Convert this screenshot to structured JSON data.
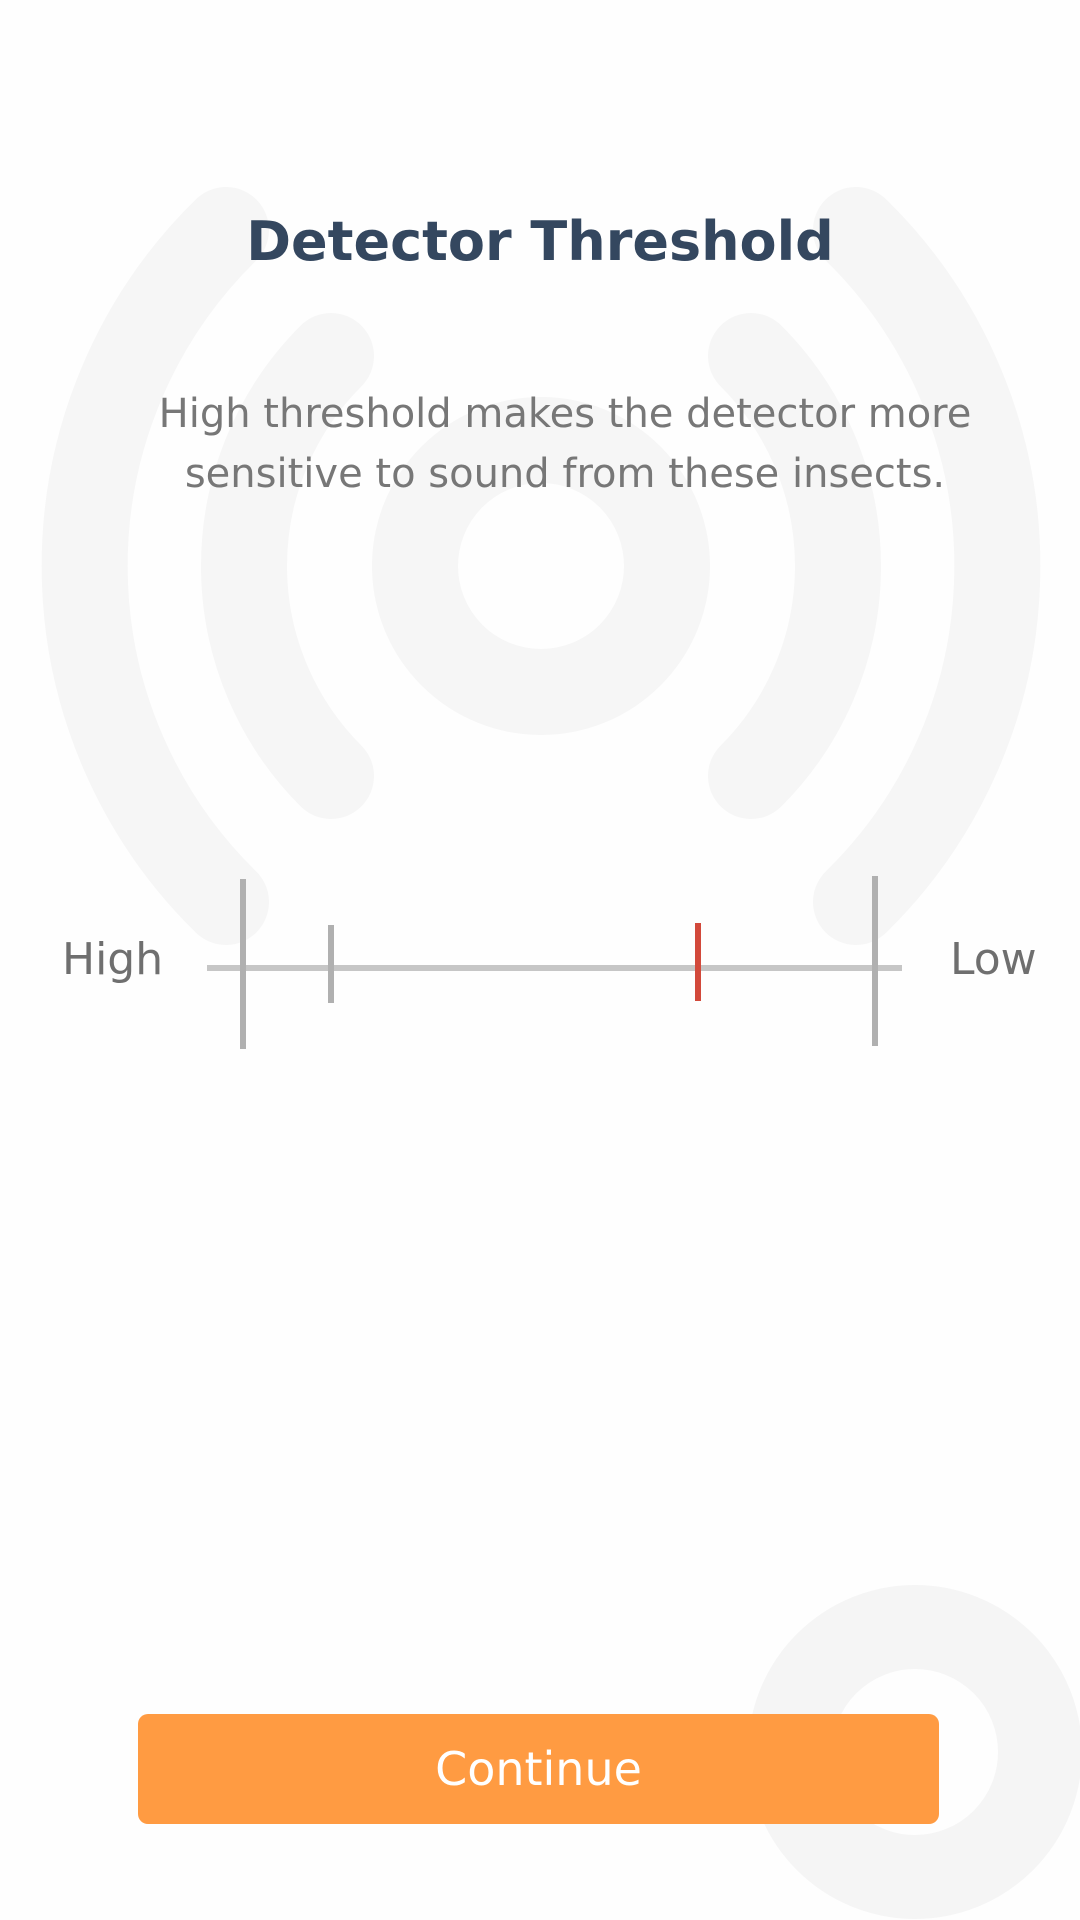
{
  "header": {
    "title": "Detector Threshold",
    "description": "High threshold makes the detector more sensitive to sound from these insects."
  },
  "threshold_slider": {
    "left_label": "High",
    "right_label": "Low",
    "value_fraction": 0.72,
    "default_marker_fraction": 0.14
  },
  "footer": {
    "continue_label": "Continue"
  },
  "colors": {
    "title": "#34475f",
    "accent_button": "#ff9b42",
    "thumb": "#d2493b",
    "track": "#c6c6c6",
    "background_art": "#f4f4f4"
  },
  "icons": {
    "background": "sound-waves-icon",
    "corner": "ring-icon"
  }
}
